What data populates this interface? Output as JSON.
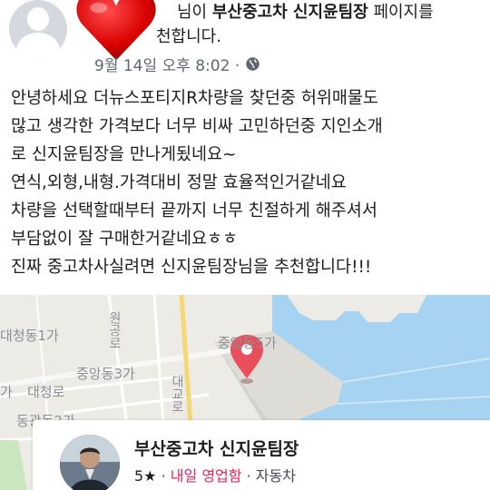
{
  "post": {
    "header_prefix": "님이 ",
    "page_name": "부산중고차 신지윤팀장",
    "header_suffix": " 페이지를",
    "header_line2": "천합니다.",
    "timestamp": "9월 14일 오후 8:02 ·",
    "body_lines": [
      "안녕하세요 더뉴스포티지R차량을 찾던중 허위매물도",
      "많고 생각한 가격보다 너무 비싸 고민하던중 지인소개",
      "로 신지윤팀장을 만나게됬네요~",
      "연식,외형,내형.가격대비 정말 효율적인거같네요",
      "차량을 선택할때부터 끝까지 너무 친절하게 해주셔서",
      "부담없이 잘 구매한거같네요ㅎㅎ",
      "진짜 중고차사실려면 신지윤팀장님을 추천합니다!!!"
    ]
  },
  "map": {
    "labels": [
      "대청동1가",
      "중앙동3가",
      "대청로",
      "동광동2가",
      "중앙동5가",
      "원공로",
      "대교로",
      "가"
    ],
    "colors": {
      "land": "#ecebe6",
      "water": "#a6d3f1",
      "pin": "#e94f5b"
    }
  },
  "page_card": {
    "name": "부산중고차 신지윤팀장",
    "rating": "5★",
    "separator1": " · ",
    "status": "내일 영업함",
    "separator2": " · ",
    "category": "자동차"
  }
}
